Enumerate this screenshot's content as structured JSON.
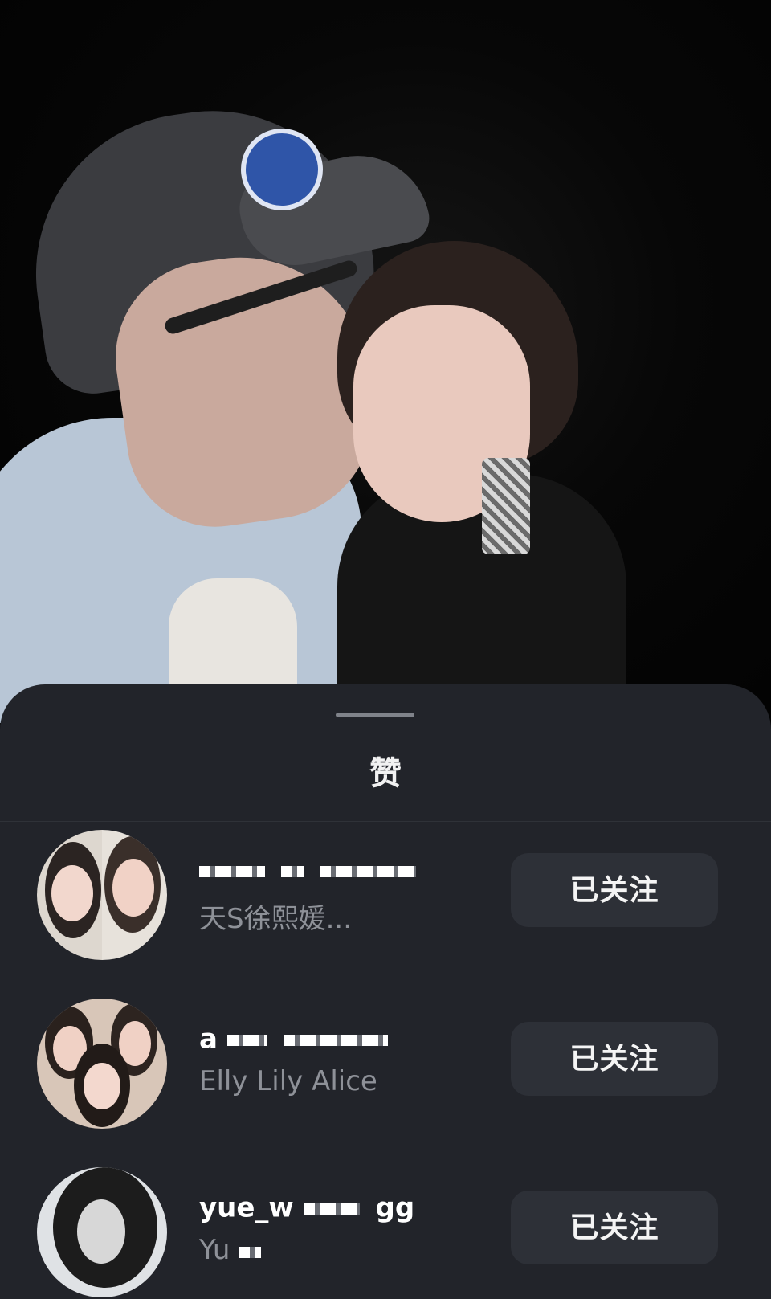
{
  "sheet": {
    "title": "赞"
  },
  "likes": [
    {
      "username_visible": "",
      "subtitle": "天S徐熙媛...",
      "button_label": "已关注"
    },
    {
      "username_visible": "a",
      "subtitle": "Elly Lily Alice",
      "button_label": "已关注"
    },
    {
      "username_visible": "yue_w",
      "username_visible_tail": "gg",
      "subtitle": "Yu",
      "button_label": "已关注"
    }
  ],
  "colors": {
    "sheet_background": "#22242a",
    "button_background": "#2d3037",
    "title_text": "#f2f2f2",
    "subtitle_text": "#8e9198"
  }
}
